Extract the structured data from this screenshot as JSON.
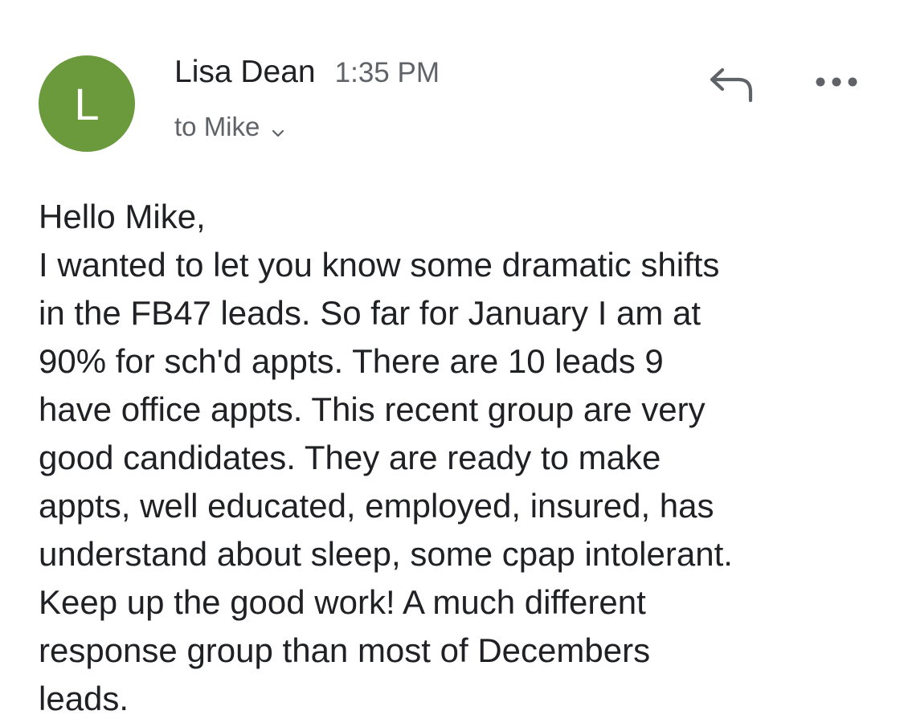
{
  "message": {
    "sender": {
      "initial": "L",
      "name": "Lisa Dean",
      "avatar_color": "#6a9a3c"
    },
    "time": "1:35 PM",
    "recipient_text": "to Mike",
    "actions": {
      "reply_icon": "reply-icon",
      "more_icon": "more-options-icon"
    },
    "body_lines": [
      "Hello Mike,",
      "I wanted to let you know some dramatic shifts",
      "in the FB47 leads. So far for January I am at",
      "90% for sch'd appts. There are 10 leads 9",
      "have office appts. This recent group are very",
      "good candidates. They are ready to make",
      "appts, well educated, employed, insured, has",
      "understand about sleep, some cpap intolerant.",
      "Keep up the good work! A much different",
      "response group than most of Decembers",
      "leads."
    ]
  }
}
